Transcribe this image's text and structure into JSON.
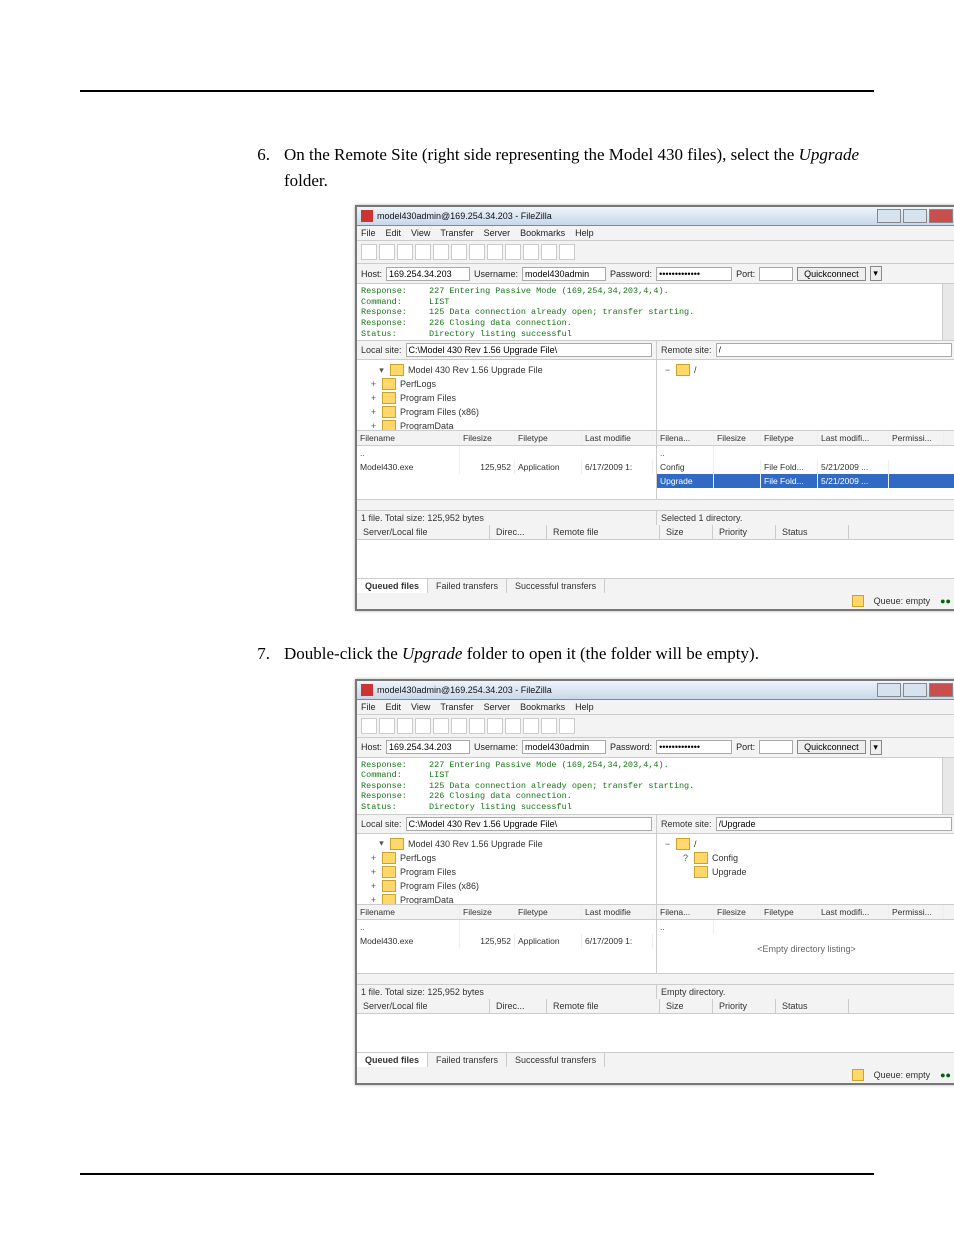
{
  "steps": {
    "s6": {
      "num": "6.",
      "text_a": "On the Remote Site (right side representing the Model 430 files), select the ",
      "em": "Upgrade",
      "text_b": " folder."
    },
    "s7": {
      "num": "7.",
      "text_a": "Double-click the ",
      "em": "Upgrade",
      "text_b": " folder to open it (the folder will be empty)."
    }
  },
  "app": {
    "title": "model430admin@169.254.34.203 - FileZilla",
    "menus": [
      "File",
      "Edit",
      "View",
      "Transfer",
      "Server",
      "Bookmarks",
      "Help"
    ],
    "conn": {
      "host_lbl": "Host:",
      "host": "169.254.34.203",
      "user_lbl": "Username:",
      "user": "model430admin",
      "pass_lbl": "Password:",
      "pass": "•••••••••••••",
      "port_lbl": "Port:",
      "port": "",
      "quick": "Quickconnect"
    },
    "log": [
      {
        "k": "Response:",
        "v": "227 Entering Passive Mode (169,254,34,203,4,4)."
      },
      {
        "k": "Command:",
        "v": "LIST"
      },
      {
        "k": "Response:",
        "v": "125 Data connection already open; transfer starting."
      },
      {
        "k": "Response:",
        "v": "226 Closing data connection."
      },
      {
        "k": "Status:",
        "v": "Directory listing successful"
      }
    ],
    "local_site_lbl": "Local site:",
    "local_site": "C:\\Model 430 Rev 1.56 Upgrade File\\",
    "remote_site_lbl": "Remote site:",
    "local_tree": [
      "Model 430 Rev 1.56 Upgrade File",
      "PerfLogs",
      "Program Files",
      "Program Files (x86)",
      "ProgramData"
    ],
    "local_cols": [
      "Filename",
      "Filesize",
      "Filetype",
      "Last modifie"
    ],
    "local_row": {
      "name": "Model430.exe",
      "size": "125,952",
      "type": "Application",
      "date": "6/17/2009 1:"
    },
    "remote_cols": [
      "Filena...",
      "Filesize",
      "Filetype",
      "Last modifi...",
      "Permissi..."
    ],
    "stat_local": "1 file. Total size: 125,952 bytes",
    "qcols": [
      "Server/Local file",
      "Direc...",
      "Remote file",
      "Size",
      "Priority",
      "Status"
    ],
    "qtabs": [
      "Queued files",
      "Failed transfers",
      "Successful transfers"
    ],
    "qfoot": "Queue: empty"
  },
  "shot1": {
    "remote_site": "/",
    "remote_tree": [
      "/"
    ],
    "remote_rows": [
      {
        "name": "Config",
        "type": "File Fold...",
        "date": "5/21/2009 ..."
      },
      {
        "name": "Upgrade",
        "type": "File Fold...",
        "date": "5/21/2009 ..."
      }
    ],
    "stat_remote": "Selected 1 directory."
  },
  "shot2": {
    "remote_site": "/Upgrade",
    "remote_tree": [
      "/",
      "Config",
      "Upgrade"
    ],
    "empty_msg": "<Empty directory listing>",
    "stat_remote": "Empty directory."
  }
}
